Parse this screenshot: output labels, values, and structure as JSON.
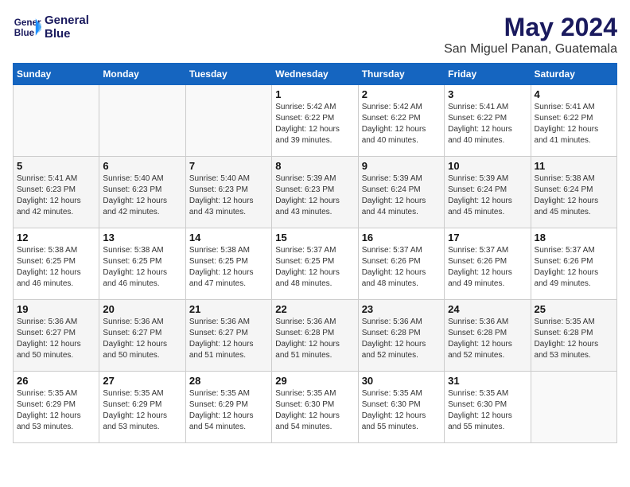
{
  "header": {
    "logo_line1": "General",
    "logo_line2": "Blue",
    "month_year": "May 2024",
    "location": "San Miguel Panan, Guatemala"
  },
  "days_of_week": [
    "Sunday",
    "Monday",
    "Tuesday",
    "Wednesday",
    "Thursday",
    "Friday",
    "Saturday"
  ],
  "weeks": [
    [
      {
        "day": "",
        "text": ""
      },
      {
        "day": "",
        "text": ""
      },
      {
        "day": "",
        "text": ""
      },
      {
        "day": "1",
        "text": "Sunrise: 5:42 AM\nSunset: 6:22 PM\nDaylight: 12 hours\nand 39 minutes."
      },
      {
        "day": "2",
        "text": "Sunrise: 5:42 AM\nSunset: 6:22 PM\nDaylight: 12 hours\nand 40 minutes."
      },
      {
        "day": "3",
        "text": "Sunrise: 5:41 AM\nSunset: 6:22 PM\nDaylight: 12 hours\nand 40 minutes."
      },
      {
        "day": "4",
        "text": "Sunrise: 5:41 AM\nSunset: 6:22 PM\nDaylight: 12 hours\nand 41 minutes."
      }
    ],
    [
      {
        "day": "5",
        "text": "Sunrise: 5:41 AM\nSunset: 6:23 PM\nDaylight: 12 hours\nand 42 minutes."
      },
      {
        "day": "6",
        "text": "Sunrise: 5:40 AM\nSunset: 6:23 PM\nDaylight: 12 hours\nand 42 minutes."
      },
      {
        "day": "7",
        "text": "Sunrise: 5:40 AM\nSunset: 6:23 PM\nDaylight: 12 hours\nand 43 minutes."
      },
      {
        "day": "8",
        "text": "Sunrise: 5:39 AM\nSunset: 6:23 PM\nDaylight: 12 hours\nand 43 minutes."
      },
      {
        "day": "9",
        "text": "Sunrise: 5:39 AM\nSunset: 6:24 PM\nDaylight: 12 hours\nand 44 minutes."
      },
      {
        "day": "10",
        "text": "Sunrise: 5:39 AM\nSunset: 6:24 PM\nDaylight: 12 hours\nand 45 minutes."
      },
      {
        "day": "11",
        "text": "Sunrise: 5:38 AM\nSunset: 6:24 PM\nDaylight: 12 hours\nand 45 minutes."
      }
    ],
    [
      {
        "day": "12",
        "text": "Sunrise: 5:38 AM\nSunset: 6:25 PM\nDaylight: 12 hours\nand 46 minutes."
      },
      {
        "day": "13",
        "text": "Sunrise: 5:38 AM\nSunset: 6:25 PM\nDaylight: 12 hours\nand 46 minutes."
      },
      {
        "day": "14",
        "text": "Sunrise: 5:38 AM\nSunset: 6:25 PM\nDaylight: 12 hours\nand 47 minutes."
      },
      {
        "day": "15",
        "text": "Sunrise: 5:37 AM\nSunset: 6:25 PM\nDaylight: 12 hours\nand 48 minutes."
      },
      {
        "day": "16",
        "text": "Sunrise: 5:37 AM\nSunset: 6:26 PM\nDaylight: 12 hours\nand 48 minutes."
      },
      {
        "day": "17",
        "text": "Sunrise: 5:37 AM\nSunset: 6:26 PM\nDaylight: 12 hours\nand 49 minutes."
      },
      {
        "day": "18",
        "text": "Sunrise: 5:37 AM\nSunset: 6:26 PM\nDaylight: 12 hours\nand 49 minutes."
      }
    ],
    [
      {
        "day": "19",
        "text": "Sunrise: 5:36 AM\nSunset: 6:27 PM\nDaylight: 12 hours\nand 50 minutes."
      },
      {
        "day": "20",
        "text": "Sunrise: 5:36 AM\nSunset: 6:27 PM\nDaylight: 12 hours\nand 50 minutes."
      },
      {
        "day": "21",
        "text": "Sunrise: 5:36 AM\nSunset: 6:27 PM\nDaylight: 12 hours\nand 51 minutes."
      },
      {
        "day": "22",
        "text": "Sunrise: 5:36 AM\nSunset: 6:28 PM\nDaylight: 12 hours\nand 51 minutes."
      },
      {
        "day": "23",
        "text": "Sunrise: 5:36 AM\nSunset: 6:28 PM\nDaylight: 12 hours\nand 52 minutes."
      },
      {
        "day": "24",
        "text": "Sunrise: 5:36 AM\nSunset: 6:28 PM\nDaylight: 12 hours\nand 52 minutes."
      },
      {
        "day": "25",
        "text": "Sunrise: 5:35 AM\nSunset: 6:28 PM\nDaylight: 12 hours\nand 53 minutes."
      }
    ],
    [
      {
        "day": "26",
        "text": "Sunrise: 5:35 AM\nSunset: 6:29 PM\nDaylight: 12 hours\nand 53 minutes."
      },
      {
        "day": "27",
        "text": "Sunrise: 5:35 AM\nSunset: 6:29 PM\nDaylight: 12 hours\nand 53 minutes."
      },
      {
        "day": "28",
        "text": "Sunrise: 5:35 AM\nSunset: 6:29 PM\nDaylight: 12 hours\nand 54 minutes."
      },
      {
        "day": "29",
        "text": "Sunrise: 5:35 AM\nSunset: 6:30 PM\nDaylight: 12 hours\nand 54 minutes."
      },
      {
        "day": "30",
        "text": "Sunrise: 5:35 AM\nSunset: 6:30 PM\nDaylight: 12 hours\nand 55 minutes."
      },
      {
        "day": "31",
        "text": "Sunrise: 5:35 AM\nSunset: 6:30 PM\nDaylight: 12 hours\nand 55 minutes."
      },
      {
        "day": "",
        "text": ""
      }
    ]
  ]
}
